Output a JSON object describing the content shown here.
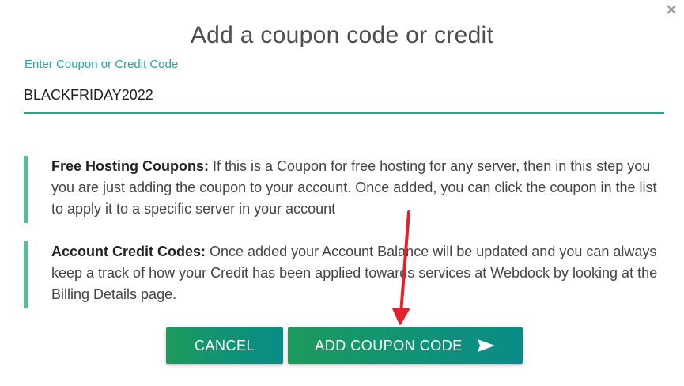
{
  "dialog": {
    "title": "Add a coupon code or credit",
    "close_icon": "close-icon"
  },
  "coupon_field": {
    "label": "Enter Coupon or Credit Code",
    "value": "BLACKFRIDAY2022"
  },
  "info_blocks": [
    {
      "heading": "Free Hosting Coupons:",
      "text": " If this is a Coupon for free hosting for any server, then in this step you you are just adding the coupon to your account. Once added, you can click the coupon in the list to apply it to a specific server in your account"
    },
    {
      "heading": "Account Credit Codes:",
      "text": " Once added your Account Balance will be updated and you can always keep a track of how your Credit has been applied towards services at Webdock by looking at the Billing Details page."
    }
  ],
  "buttons": {
    "cancel_label": "CANCEL",
    "add_label": "ADD COUPON CODE",
    "add_icon": "send-icon"
  },
  "colors": {
    "accent": "#26a69a",
    "info_border": "#48c496",
    "button_start": "#1e9a5c",
    "button_end": "#0a8b87",
    "annotation_arrow": "#e3222b"
  }
}
